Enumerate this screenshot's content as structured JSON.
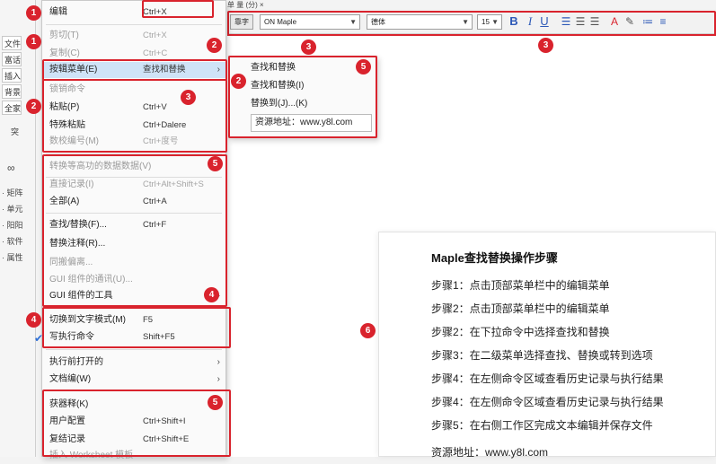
{
  "left_panel": {
    "buttons": [
      "文件",
      "富话",
      "插入",
      "背景",
      "全家"
    ],
    "tab": "突",
    "items": [
      "· 矩阵",
      "· 单元",
      "· 阳阳",
      "· 软件",
      "· 属性"
    ]
  },
  "tab_strip": {
    "label": "单 量 (分) ×"
  },
  "toolbar": {
    "style_btn": "靠字",
    "font_family": "ON Maple",
    "font_name": "德体",
    "font_size": "15",
    "bold": "B",
    "italic": "I",
    "underline": "U"
  },
  "main_menu": {
    "top_item": {
      "label": "编辑",
      "shortcut": "Ctrl+X"
    },
    "items": [
      {
        "label": "剪切(T)",
        "shortcut": "Ctrl+X",
        "disabled": true
      },
      {
        "label": "复制(C)",
        "shortcut": "Ctrl+C",
        "disabled": true
      },
      {
        "label": "按辑菜单(E)",
        "shortcut": "查找和替换",
        "submenu": true,
        "highlight": true
      },
      {
        "label": "锁销命令",
        "shortcut": "",
        "disabled": true
      },
      {
        "label": "粘贴(P)",
        "shortcut": "Ctrl+V"
      },
      {
        "label": "特殊粘贴",
        "shortcut": "Ctrl+Dalere"
      },
      {
        "label": "数校编号(M)",
        "shortcut": "Ctrl+度号",
        "disabled": true
      },
      {
        "label": "转换等高功的数据数据(V)",
        "shortcut": "",
        "disabled": true
      },
      {
        "label": "直接记录(I)",
        "shortcut": "Ctrl+Alt+Shift+S",
        "disabled": true
      },
      {
        "label": "全部(A)",
        "shortcut": "Ctrl+A"
      },
      {
        "label": "查找/替换(F)...",
        "shortcut": "Ctrl+F"
      },
      {
        "label": "替换注释(R)...",
        "shortcut": ""
      },
      {
        "label": "同搬偏离...",
        "shortcut": "",
        "disabled": true
      },
      {
        "label": "GUI 组件的通讯(U)...",
        "shortcut": "",
        "disabled": true
      },
      {
        "label": "GUI 组件的工具",
        "shortcut": "",
        "submenu": true
      },
      {
        "label": "切换到文字模式(M)",
        "shortcut": "F5"
      },
      {
        "label": "写执行命令",
        "shortcut": "Shift+F5",
        "checked": true
      },
      {
        "label": "执行前打开的",
        "shortcut": "",
        "submenu": true
      },
      {
        "label": "文档编(W)",
        "shortcut": "",
        "submenu": true
      },
      {
        "label": "获器释(K)",
        "shortcut": ""
      },
      {
        "label": "用户配置",
        "shortcut": "Ctrl+Shift+I"
      },
      {
        "label": "复结记录",
        "shortcut": "Ctrl+Shift+E"
      },
      {
        "label": "插入 Worksheet 模板",
        "shortcut": "",
        "disabled": true
      }
    ]
  },
  "submenu": {
    "items": [
      "查找和替换",
      "查找和替换(I)",
      "替换到(J)...(K)"
    ],
    "resource": "资源地址：www.y8l.com"
  },
  "badges": [
    "1",
    "1",
    "2",
    "2",
    "2",
    "3",
    "3",
    "3",
    "4",
    "4",
    "5",
    "5",
    "5",
    "6"
  ],
  "steps_panel": {
    "title": "Maple查找替换操作步骤",
    "steps": [
      "步骤1：点击顶部菜单栏中的编辑菜单",
      "步骤2：点击顶部菜单栏中的编辑菜单",
      "步骤2：在下拉命令中选择查找和替换",
      "步骤3：在二级菜单选择查找、替换或转到选项",
      "步骤4：在左侧命令区域查看历史记录与执行结果",
      "步骤4：在左侧命令区域查看历史记录与执行结果",
      "步骤5：在右侧工作区完成文本编辑并保存文件"
    ],
    "footer": "资源地址：www.y8l.com"
  },
  "colors": {
    "annotation_red": "#d9232d",
    "highlight": "#cfe3f7",
    "accent_blue": "#2d59b7"
  }
}
